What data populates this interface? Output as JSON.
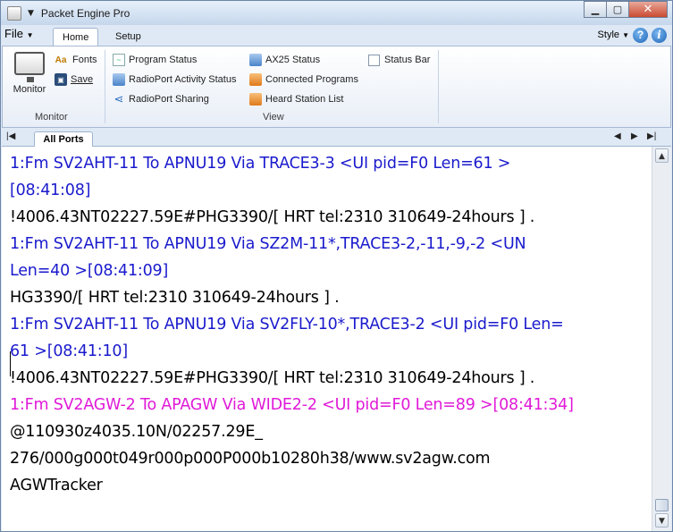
{
  "window": {
    "title": "Packet Engine Pro"
  },
  "ribbon": {
    "file_label": "File",
    "tabs": [
      {
        "label": "Home"
      },
      {
        "label": "Setup"
      }
    ],
    "style_label": "Style",
    "monitor_group": {
      "monitor_label": "Monitor",
      "fonts_label": "Fonts",
      "save_label": "Save",
      "group_label": "Monitor"
    },
    "view_group": {
      "program_status": "Program Status",
      "radioport_activity_status": "RadioPort Activity Status",
      "radioport_sharing": "RadioPort Sharing",
      "ax25_status": "AX25 Status",
      "connected_programs": "Connected Programs",
      "heard_station_list": "Heard Station List",
      "status_bar": "Status Bar",
      "group_label": "View"
    }
  },
  "doc_tabs": [
    {
      "label": "All Ports"
    }
  ],
  "monitor_lines": [
    {
      "text": " 1:Fm SV2AHT-11 To APNU19 Via TRACE3-3 <UI pid=F0 Len=61 >",
      "color": "#1a1acd"
    },
    {
      "text": "[08:41:08]",
      "color": "#1a1acd"
    },
    {
      "text": "!4006.43NT02227.59E#PHG3390/[ HRT tel:2310 310649-24hours ] .",
      "color": "#000000"
    },
    {
      "text": " 1:Fm SV2AHT-11 To APNU19 Via SZ2M-11*,TRACE3-2,-11,-9,-2 <UN",
      "color": "#1a1acd"
    },
    {
      "text": "Len=40 >[08:41:09]",
      "color": "#1a1acd"
    },
    {
      "text": "HG3390/[ HRT tel:2310 310649-24hours ] .",
      "color": "#000000"
    },
    {
      "text": " 1:Fm SV2AHT-11 To APNU19 Via SV2FLY-10*,TRACE3-2 <UI pid=F0 Len=",
      "color": "#1a1acd"
    },
    {
      "text": "61 >[08:41:10]",
      "color": "#1a1acd"
    },
    {
      "text": "!4006.43NT02227.59E#PHG3390/[ HRT tel:2310 310649-24hours ] .",
      "color": "#000000"
    },
    {
      "text": " 1:Fm SV2AGW-2 To APAGW Via WIDE2-2 <UI pid=F0 Len=89 >[08:41:34]",
      "color": "#e01ad8"
    },
    {
      "text": "@110930z4035.10N/02257.29E_",
      "color": "#000000"
    },
    {
      "text": "276/000g000t049r000p000P000b10280h38/www.sv2agw.com",
      "color": "#000000"
    },
    {
      "text": "AGWTracker",
      "color": "#000000"
    }
  ]
}
